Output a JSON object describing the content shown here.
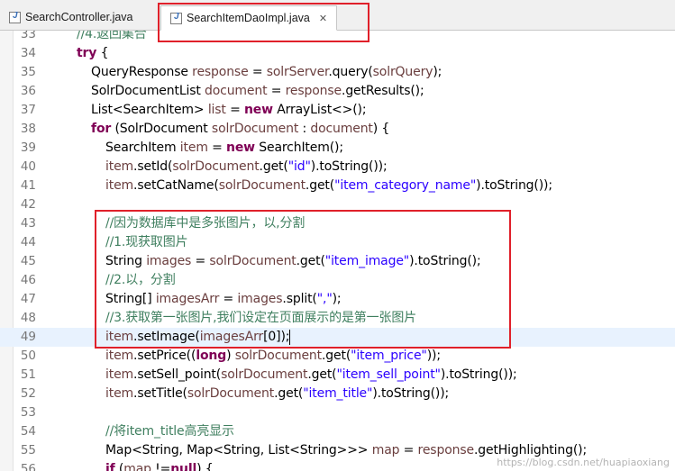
{
  "tabs": [
    {
      "label": "SearchController.java",
      "active": false
    },
    {
      "label": "SearchItemDaoImpl.java",
      "active": true,
      "close_glyph": "✕"
    }
  ],
  "editor": {
    "current_line": 49,
    "lines": [
      {
        "num": "33",
        "indent": 2,
        "tokens": [
          {
            "t": "//4.返回集合",
            "c": "cm"
          }
        ]
      },
      {
        "num": "34",
        "indent": 2,
        "tokens": [
          {
            "t": "try",
            "c": "kw"
          },
          {
            "t": " {",
            "c": "pl"
          }
        ]
      },
      {
        "num": "35",
        "indent": 3,
        "tokens": [
          {
            "t": "QueryResponse ",
            "c": "pl"
          },
          {
            "t": "response",
            "c": "var"
          },
          {
            "t": " = ",
            "c": "pl"
          },
          {
            "t": "solrServer",
            "c": "var"
          },
          {
            "t": ".query(",
            "c": "pl"
          },
          {
            "t": "solrQuery",
            "c": "var"
          },
          {
            "t": ");",
            "c": "pl"
          }
        ]
      },
      {
        "num": "36",
        "indent": 3,
        "tokens": [
          {
            "t": "SolrDocumentList ",
            "c": "pl"
          },
          {
            "t": "document",
            "c": "var"
          },
          {
            "t": " = ",
            "c": "pl"
          },
          {
            "t": "response",
            "c": "var"
          },
          {
            "t": ".getResults();",
            "c": "pl"
          }
        ]
      },
      {
        "num": "37",
        "indent": 3,
        "tokens": [
          {
            "t": "List<SearchItem> ",
            "c": "pl"
          },
          {
            "t": "list",
            "c": "var"
          },
          {
            "t": " = ",
            "c": "pl"
          },
          {
            "t": "new",
            "c": "kw"
          },
          {
            "t": " ArrayList<>();",
            "c": "pl"
          }
        ]
      },
      {
        "num": "38",
        "indent": 3,
        "tokens": [
          {
            "t": "for",
            "c": "kw"
          },
          {
            "t": " (SolrDocument ",
            "c": "pl"
          },
          {
            "t": "solrDocument",
            "c": "var"
          },
          {
            "t": " : ",
            "c": "pl"
          },
          {
            "t": "document",
            "c": "var"
          },
          {
            "t": ") {",
            "c": "pl"
          }
        ]
      },
      {
        "num": "39",
        "indent": 4,
        "tokens": [
          {
            "t": "SearchItem ",
            "c": "pl"
          },
          {
            "t": "item",
            "c": "var"
          },
          {
            "t": " = ",
            "c": "pl"
          },
          {
            "t": "new",
            "c": "kw"
          },
          {
            "t": " SearchItem();",
            "c": "pl"
          }
        ]
      },
      {
        "num": "40",
        "indent": 4,
        "tokens": [
          {
            "t": "item",
            "c": "var"
          },
          {
            "t": ".setId(",
            "c": "pl"
          },
          {
            "t": "solrDocument",
            "c": "var"
          },
          {
            "t": ".get(",
            "c": "pl"
          },
          {
            "t": "\"id\"",
            "c": "str"
          },
          {
            "t": ").toString());",
            "c": "pl"
          }
        ]
      },
      {
        "num": "41",
        "indent": 4,
        "tokens": [
          {
            "t": "item",
            "c": "var"
          },
          {
            "t": ".setCatName(",
            "c": "pl"
          },
          {
            "t": "solrDocument",
            "c": "var"
          },
          {
            "t": ".get(",
            "c": "pl"
          },
          {
            "t": "\"item_category_name\"",
            "c": "str"
          },
          {
            "t": ").toString());",
            "c": "pl"
          }
        ]
      },
      {
        "num": "42",
        "indent": 4,
        "tokens": []
      },
      {
        "num": "43",
        "indent": 4,
        "tokens": [
          {
            "t": "//因为数据库中是多张图片，以,分割",
            "c": "cm"
          }
        ]
      },
      {
        "num": "44",
        "indent": 4,
        "tokens": [
          {
            "t": "//1.现获取图片",
            "c": "cm"
          }
        ]
      },
      {
        "num": "45",
        "indent": 4,
        "tokens": [
          {
            "t": "String ",
            "c": "pl"
          },
          {
            "t": "images",
            "c": "var"
          },
          {
            "t": " = ",
            "c": "pl"
          },
          {
            "t": "solrDocument",
            "c": "var"
          },
          {
            "t": ".get(",
            "c": "pl"
          },
          {
            "t": "\"item_image\"",
            "c": "str"
          },
          {
            "t": ").toString();",
            "c": "pl"
          }
        ]
      },
      {
        "num": "46",
        "indent": 4,
        "tokens": [
          {
            "t": "//2.以，分割",
            "c": "cm"
          }
        ]
      },
      {
        "num": "47",
        "indent": 4,
        "tokens": [
          {
            "t": "String[] ",
            "c": "pl"
          },
          {
            "t": "imagesArr",
            "c": "var"
          },
          {
            "t": " = ",
            "c": "pl"
          },
          {
            "t": "images",
            "c": "var"
          },
          {
            "t": ".split(",
            "c": "pl"
          },
          {
            "t": "\",\"",
            "c": "str"
          },
          {
            "t": ");",
            "c": "pl"
          }
        ]
      },
      {
        "num": "48",
        "indent": 4,
        "tokens": [
          {
            "t": "//3.获取第一张图片,我们设定在页面展示的是第一张图片",
            "c": "cm"
          }
        ]
      },
      {
        "num": "49",
        "indent": 4,
        "tokens": [
          {
            "t": "item",
            "c": "var"
          },
          {
            "t": ".setImage(",
            "c": "pl"
          },
          {
            "t": "imagesArr",
            "c": "var"
          },
          {
            "t": "[0]);",
            "c": "pl"
          }
        ]
      },
      {
        "num": "50",
        "indent": 4,
        "tokens": [
          {
            "t": "item",
            "c": "var"
          },
          {
            "t": ".setPrice((",
            "c": "pl"
          },
          {
            "t": "long",
            "c": "kw"
          },
          {
            "t": ") ",
            "c": "pl"
          },
          {
            "t": "solrDocument",
            "c": "var"
          },
          {
            "t": ".get(",
            "c": "pl"
          },
          {
            "t": "\"item_price\"",
            "c": "str"
          },
          {
            "t": "));",
            "c": "pl"
          }
        ]
      },
      {
        "num": "51",
        "indent": 4,
        "tokens": [
          {
            "t": "item",
            "c": "var"
          },
          {
            "t": ".setSell_point(",
            "c": "pl"
          },
          {
            "t": "solrDocument",
            "c": "var"
          },
          {
            "t": ".get(",
            "c": "pl"
          },
          {
            "t": "\"item_sell_point\"",
            "c": "str"
          },
          {
            "t": ").toString());",
            "c": "pl"
          }
        ]
      },
      {
        "num": "52",
        "indent": 4,
        "tokens": [
          {
            "t": "item",
            "c": "var"
          },
          {
            "t": ".setTitle(",
            "c": "pl"
          },
          {
            "t": "solrDocument",
            "c": "var"
          },
          {
            "t": ".get(",
            "c": "pl"
          },
          {
            "t": "\"item_title\"",
            "c": "str"
          },
          {
            "t": ").toString());",
            "c": "pl"
          }
        ]
      },
      {
        "num": "53",
        "indent": 4,
        "tokens": []
      },
      {
        "num": "54",
        "indent": 4,
        "tokens": [
          {
            "t": "//将item_title高亮显示",
            "c": "cm"
          }
        ]
      },
      {
        "num": "55",
        "indent": 4,
        "tokens": [
          {
            "t": "Map<String, Map<String, List<String>>> ",
            "c": "pl"
          },
          {
            "t": "map",
            "c": "var"
          },
          {
            "t": " = ",
            "c": "pl"
          },
          {
            "t": "response",
            "c": "var"
          },
          {
            "t": ".getHighlighting();",
            "c": "pl"
          }
        ]
      },
      {
        "num": "56",
        "indent": 4,
        "tokens": [
          {
            "t": "if",
            "c": "kw"
          },
          {
            "t": " (",
            "c": "pl"
          },
          {
            "t": "map",
            "c": "var"
          },
          {
            "t": " !=",
            "c": "pl"
          },
          {
            "t": "null",
            "c": "kw"
          },
          {
            "t": ") {",
            "c": "pl"
          }
        ]
      }
    ]
  },
  "watermark": "https://blog.csdn.net/huapiaoxiang",
  "colors": {
    "keyword": "#7f0055",
    "variable": "#6a3e3e",
    "string": "#2a00ff",
    "comment": "#3f7f5f",
    "highlight_box": "#e0202a",
    "current_line": "#e8f2fe"
  }
}
